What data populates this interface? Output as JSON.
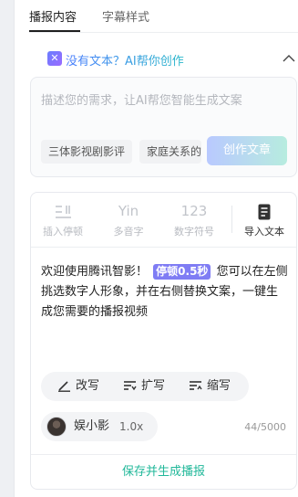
{
  "tabs": [
    {
      "label": "播报内容",
      "active": true
    },
    {
      "label": "字幕样式",
      "active": false
    }
  ],
  "ai": {
    "icon": "ai-sparkle-icon",
    "title": "没有文本？AI帮你创作",
    "placeholder": "描述您的需求，让AI帮您智能生成文案",
    "chips": [
      "三体影视剧影评",
      "家庭关系的"
    ],
    "generate_label": "创作文章"
  },
  "toolbar": {
    "items": [
      {
        "label": "插入停顿",
        "glyph": "⁞",
        "icon": "insert-pause-icon",
        "enabled": false
      },
      {
        "label": "多音字",
        "glyph": "Yin",
        "icon": "polyphone-icon",
        "enabled": false
      },
      {
        "label": "数字符号",
        "glyph": "123",
        "icon": "number-symbol-icon",
        "enabled": false
      },
      {
        "label": "导入文本",
        "glyph": "",
        "icon": "import-document-icon",
        "enabled": true
      }
    ]
  },
  "content": {
    "before_tag": "欢迎使用腾讯智影！",
    "pause_tag": "停顿0.5秒",
    "after_tag": "您可以在左侧挑选数字人形象，并在右侧替换文案，一键生成您需要的播报视频"
  },
  "rewrite": {
    "rewrite_label": "改写",
    "expand_label": "扩写",
    "shorten_label": "缩写"
  },
  "voice": {
    "name": "娱小影",
    "speed": "1.0x"
  },
  "counter": "44/5000",
  "save_label": "保存并生成播报",
  "colors": {
    "accent_green": "#22b89a",
    "pause_tag_bg": "#7f7cf4",
    "ai_gradient_start": "#4a7dff",
    "ai_gradient_end": "#27b7c9"
  }
}
